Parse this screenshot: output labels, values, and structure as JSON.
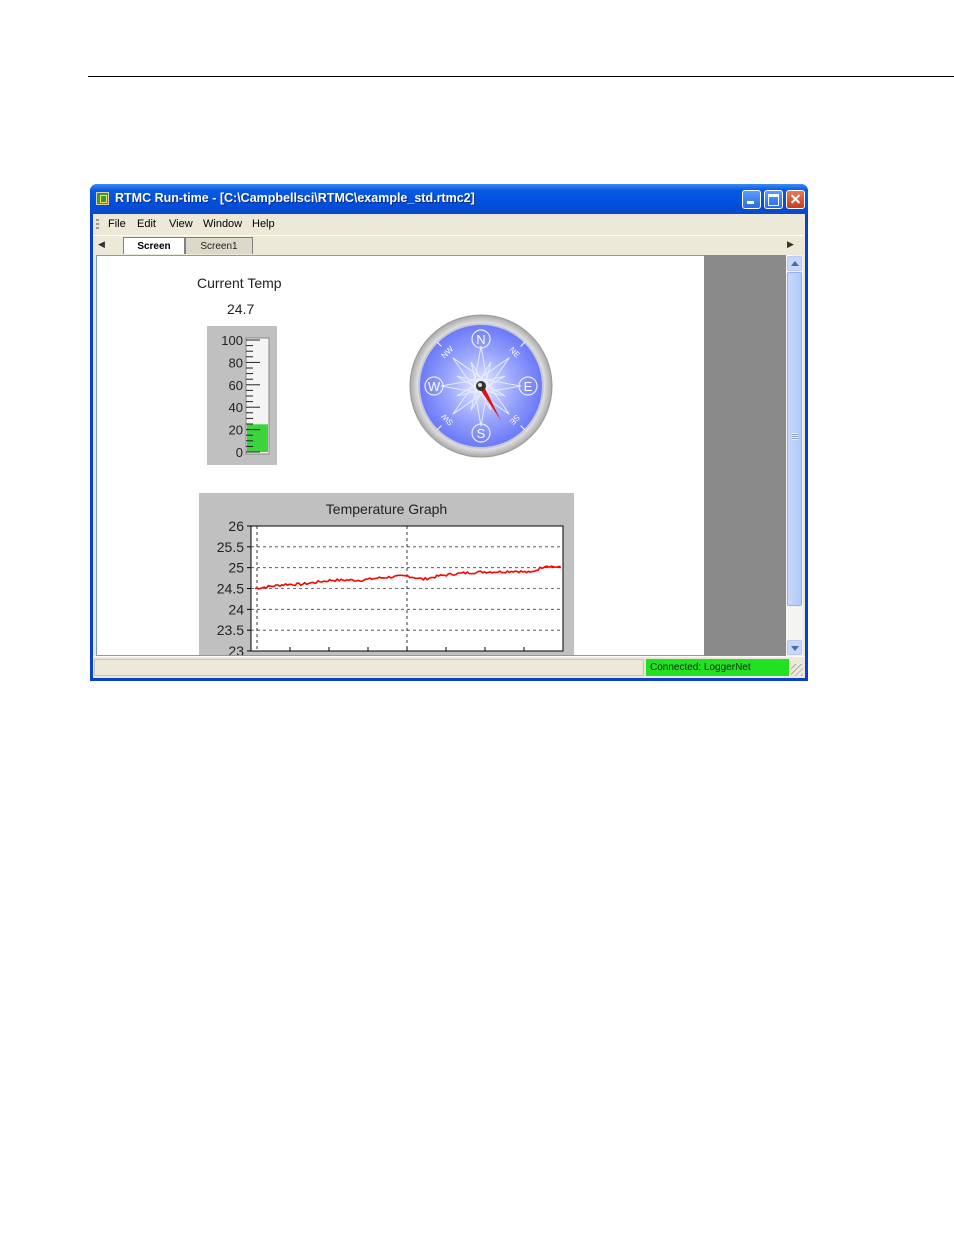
{
  "window": {
    "title": "RTMC Run-time - [C:\\Campbellsci\\RTMC\\example_std.rtmc2]"
  },
  "menu": {
    "items": [
      "File",
      "Edit",
      "View",
      "Window",
      "Help"
    ]
  },
  "tabs": {
    "items": [
      {
        "label": "Screen",
        "active": true
      },
      {
        "label": "Screen1",
        "active": false
      }
    ]
  },
  "thermometer": {
    "title": "Current Temp",
    "value": "24.7",
    "fill_fraction": 0.247,
    "ticks": [
      "100",
      "80",
      "60",
      "40",
      "20",
      "0"
    ],
    "fill_color": "#3cd43c"
  },
  "compass": {
    "cardinals": [
      "N",
      "E",
      "S",
      "W"
    ],
    "intercardinals": [
      "NE",
      "SE",
      "SW",
      "NW"
    ],
    "needle_direction_deg": 150,
    "face_color": "#6a78f8",
    "needle_color": "#e01010"
  },
  "chart_data": {
    "type": "line",
    "title": "Temperature Graph",
    "xlabel": "",
    "ylabel": "",
    "ylim": [
      23,
      26
    ],
    "yticks": [
      "26",
      "25.5",
      "25",
      "24.5",
      "24",
      "23.5",
      "23"
    ],
    "grid": true,
    "series": [
      {
        "color": "#ff0000",
        "x": [
          0,
          5,
          10,
          15,
          20,
          25,
          30,
          35,
          40,
          45,
          50,
          55,
          60,
          65,
          70,
          75,
          80,
          85,
          90,
          95,
          100
        ],
        "values": [
          24.5,
          24.55,
          24.6,
          24.6,
          24.65,
          24.7,
          24.7,
          24.7,
          24.75,
          24.78,
          24.8,
          24.72,
          24.8,
          24.85,
          24.88,
          24.9,
          24.9,
          24.92,
          24.88,
          25.05,
          25.0
        ]
      }
    ]
  },
  "status": {
    "connection": "Connected: LoggerNet",
    "connection_color": "#22e022"
  }
}
